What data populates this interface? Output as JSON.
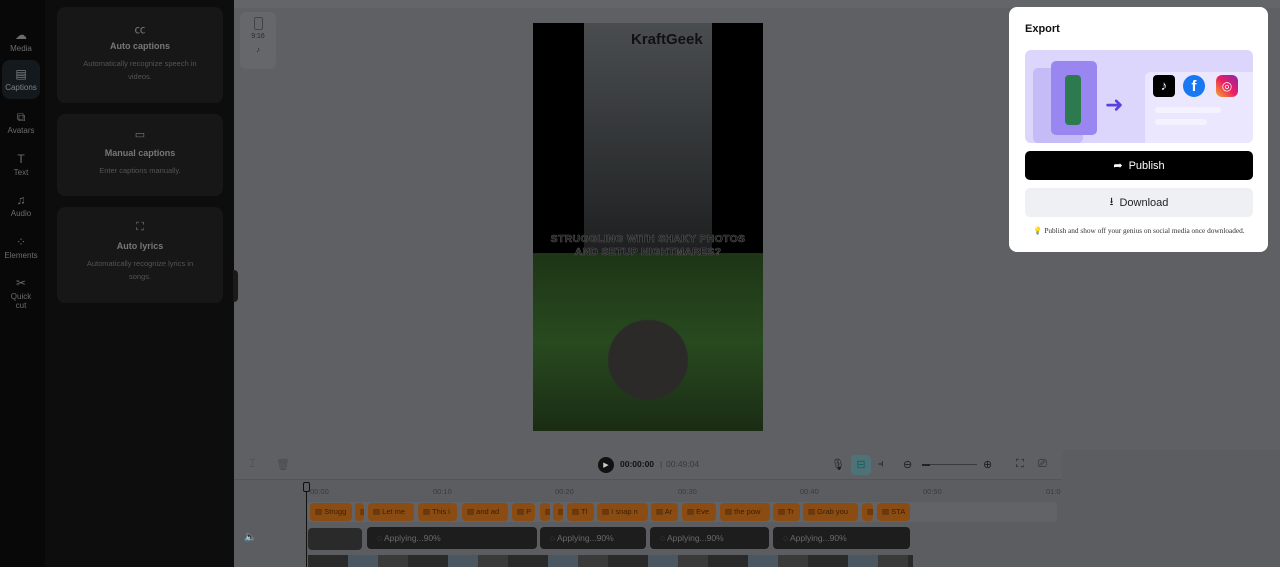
{
  "nav": [
    {
      "label": "Media",
      "icon": "cloud-upload"
    },
    {
      "label": "Captions",
      "icon": "captions"
    },
    {
      "label": "Avatars",
      "icon": "avatar"
    },
    {
      "label": "Text",
      "icon": "text"
    },
    {
      "label": "Audio",
      "icon": "music-note"
    },
    {
      "label": "Elements",
      "icon": "shapes"
    },
    {
      "label": "Quick cut",
      "icon": "scissors"
    }
  ],
  "panel": {
    "cards": [
      {
        "title": "Auto captions",
        "desc": "Automatically recognize speech in videos.",
        "icon": "cc"
      },
      {
        "title": "Manual captions",
        "desc": "Enter captions manually.",
        "icon": "keyboard"
      },
      {
        "title": "Auto lyrics",
        "desc": "Automatically recognize lyrics in songs.",
        "icon": "music-scan"
      }
    ]
  },
  "canvas": {
    "ratio": "9:16",
    "video_logo": "KraftGeek",
    "video_subtitle": "STRUGGLING WITH SHAKY PHOTOS AND SETUP NIGHTMARES?"
  },
  "export": {
    "title": "Export",
    "publish": "Publish",
    "download": "Download",
    "tip": "Publish and show off your genius on social media once downloaded."
  },
  "timeline": {
    "current": "00:00:00",
    "total": "00:49:04",
    "ticks": [
      "00:00",
      "00:10",
      "00:20",
      "00:30",
      "00:40",
      "00:50",
      "01:0"
    ],
    "captions": [
      "Strugg",
      "I",
      "Let me",
      "This i",
      "and ad",
      "P",
      "(",
      "(",
      "Tl",
      "I snap n",
      "Ar",
      "Eve",
      "the pow",
      "Tr",
      "Grab you",
      "E",
      "STA"
    ],
    "applying": [
      "Applying...90%",
      "Applying...90%",
      "Applying...90%",
      "Applying...90%"
    ]
  }
}
